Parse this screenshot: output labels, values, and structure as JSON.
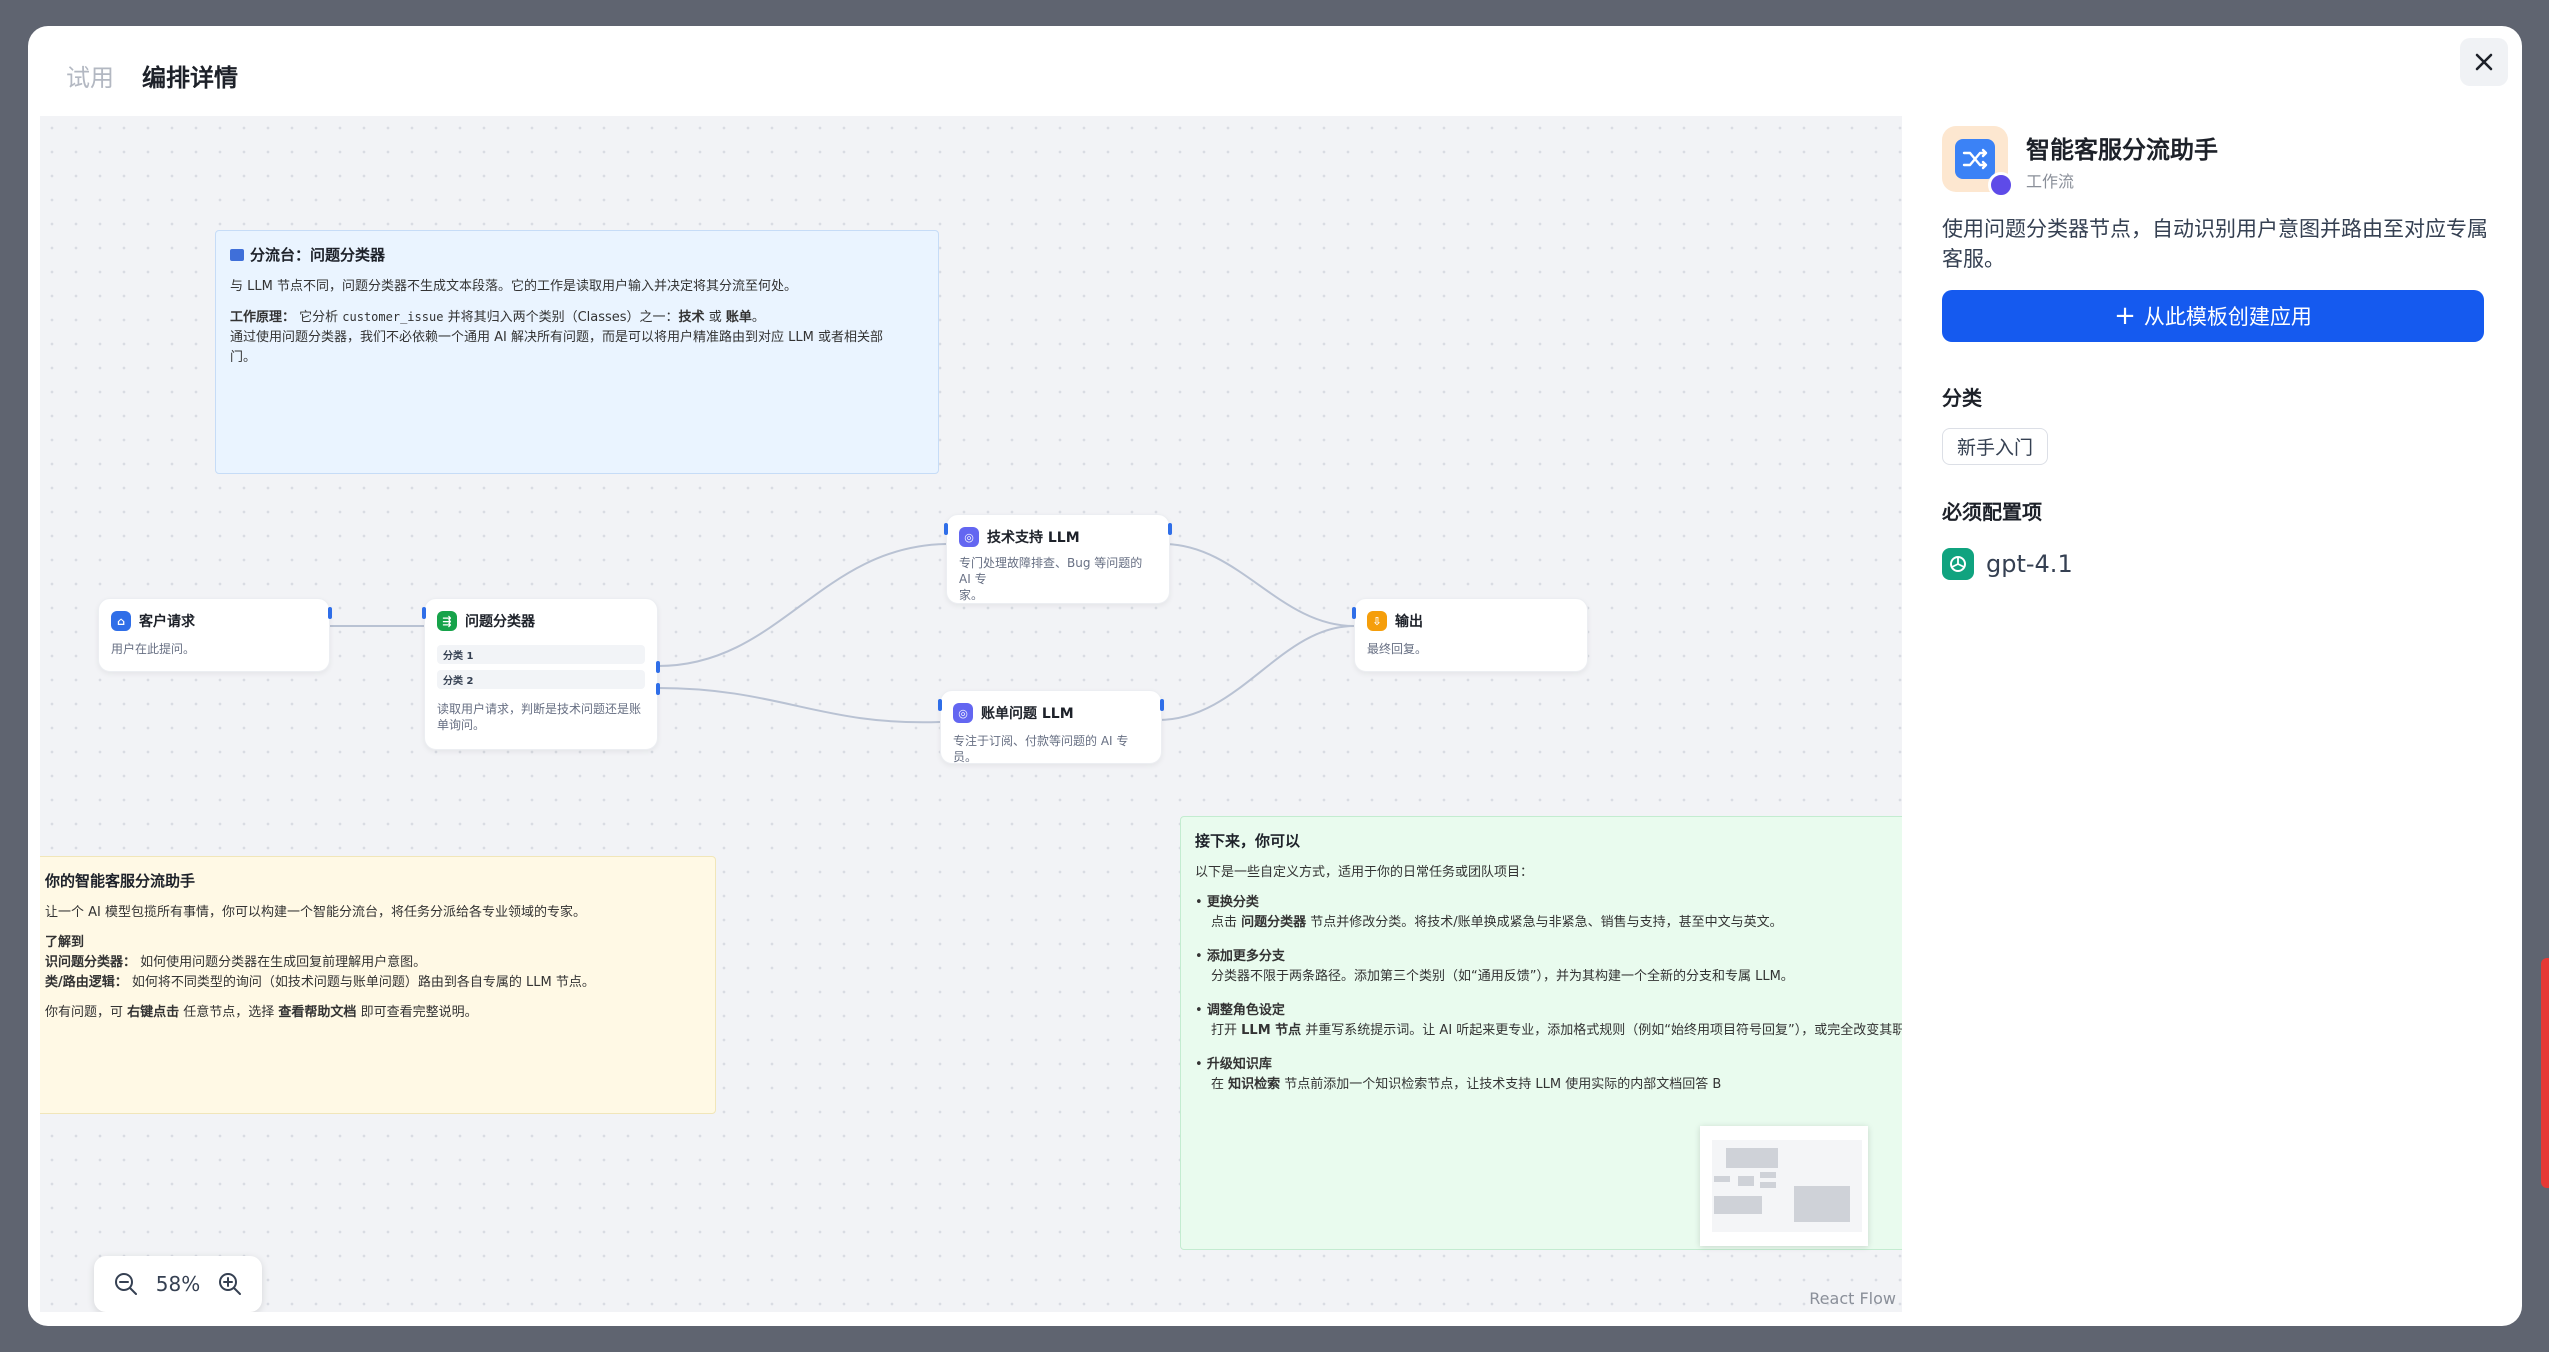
{
  "tabs": [
    {
      "label": "试用",
      "active": false
    },
    {
      "label": "编排详情",
      "active": true
    }
  ],
  "close_icon": "close-icon",
  "canvas": {
    "note_blue": {
      "title": "分流台：问题分类器",
      "line1": "与 LLM 节点不同，问题分类器不生成文本段落。它的工作是读取用户输入并决定将其分流至何处。",
      "line2_label": "工作原理：",
      "line2_a": " 它分析 ",
      "line2_code": "customer_issue",
      "line2_b": " 并将其归入两个类别（Classes）之一：",
      "line2_tech": "技术",
      "line2_or": " 或 ",
      "line2_bill": "账单",
      "line2_end": "。",
      "line3": "通过使用问题分类器，我们不必依赖一个通用 AI 解决所有问题，而是可以将用户精准路由到对应 LLM 或者相关部",
      "line4": "门。"
    },
    "nodes": {
      "start": {
        "title": "客户请求",
        "desc": "用户在此提问。"
      },
      "classifier": {
        "title": "问题分类器",
        "class1": "分类 1",
        "class2": "分类 2",
        "desc1": "读取用户请求，判断是技术问题还是账",
        "desc2": "单询问。"
      },
      "tech": {
        "title": "技术支持 LLM",
        "desc1": "专门处理故障排查、Bug 等问题的 AI 专",
        "desc2": "家。"
      },
      "bill": {
        "title": "账单问题 LLM",
        "desc": "专注于订阅、付款等问题的 AI 专员。"
      },
      "output": {
        "title": "输出",
        "desc": "最终回复。"
      }
    },
    "note_yellow": {
      "title": "你的智能客服分流助手",
      "line1": "让一个 AI 模型包揽所有事情，你可以构建一个智能分流台，将任务分派给各专业领域的专家。",
      "h2": "了解到",
      "l2a": "识问题分类器：",
      "l2b": " 如何使用问题分类器在生成回复前理解用户意图。",
      "l3a": "类/路由逻辑：",
      "l3b": " 如何将不同类型的询问（如技术问题与账单问题）路由到各自专属的 LLM 节点。",
      "l4a": "你有问题，可 ",
      "l4b": "右键点击",
      "l4c": " 任意节点，选择 ",
      "l4d": "查看帮助文档",
      "l4e": " 即可查看完整说明。"
    },
    "note_green": {
      "title": "接下来，你可以",
      "intro": "以下是一些自定义方式，适用于你的日常任务或团队项目：",
      "items": [
        {
          "head": "更换分类",
          "body_a": "点击 ",
          "body_b": "问题分类器",
          "body_c": " 节点并修改分类。将技术/账单换成紧急与非紧急、销售与支持，甚至中文与英文。"
        },
        {
          "head": "添加更多分支",
          "body_a": "分类器不限于两条路径。添加第三个类别（如“通用反馈”），并为其构建一个全新的分支和专属 LLM。",
          "body_b": "",
          "body_c": ""
        },
        {
          "head": "调整角色设定",
          "body_a": "打开 ",
          "body_b": "LLM 节点",
          "body_c": " 并重写系统提示词。让 AI 听起来更专业，添加格式规则（例如“始终用项目符号回复”），或完全改变其职"
        },
        {
          "head": "升级知识库",
          "body_a": "在 ",
          "body_b": "知识检索",
          "body_c": " 节点前添加一个知识检索节点，让技术支持 LLM 使用实际的内部文档回答 B"
        }
      ]
    },
    "zoom": {
      "level": "58%"
    },
    "attribution": "React Flow"
  },
  "panel": {
    "app_name": "智能客服分流助手",
    "app_type": "工作流",
    "description": "使用问题分类器节点，自动识别用户意图并路由至对应专属客服。",
    "create_button": "从此模板创建应用",
    "category_title": "分类",
    "category_tag": "新手入门",
    "required_title": "必须配置项",
    "model": "gpt-4.1"
  },
  "colors": {
    "accent": "#155aef",
    "note_blue": "#eaf4ff",
    "note_yellow": "#fff9e5",
    "note_green": "#e9fbee"
  }
}
